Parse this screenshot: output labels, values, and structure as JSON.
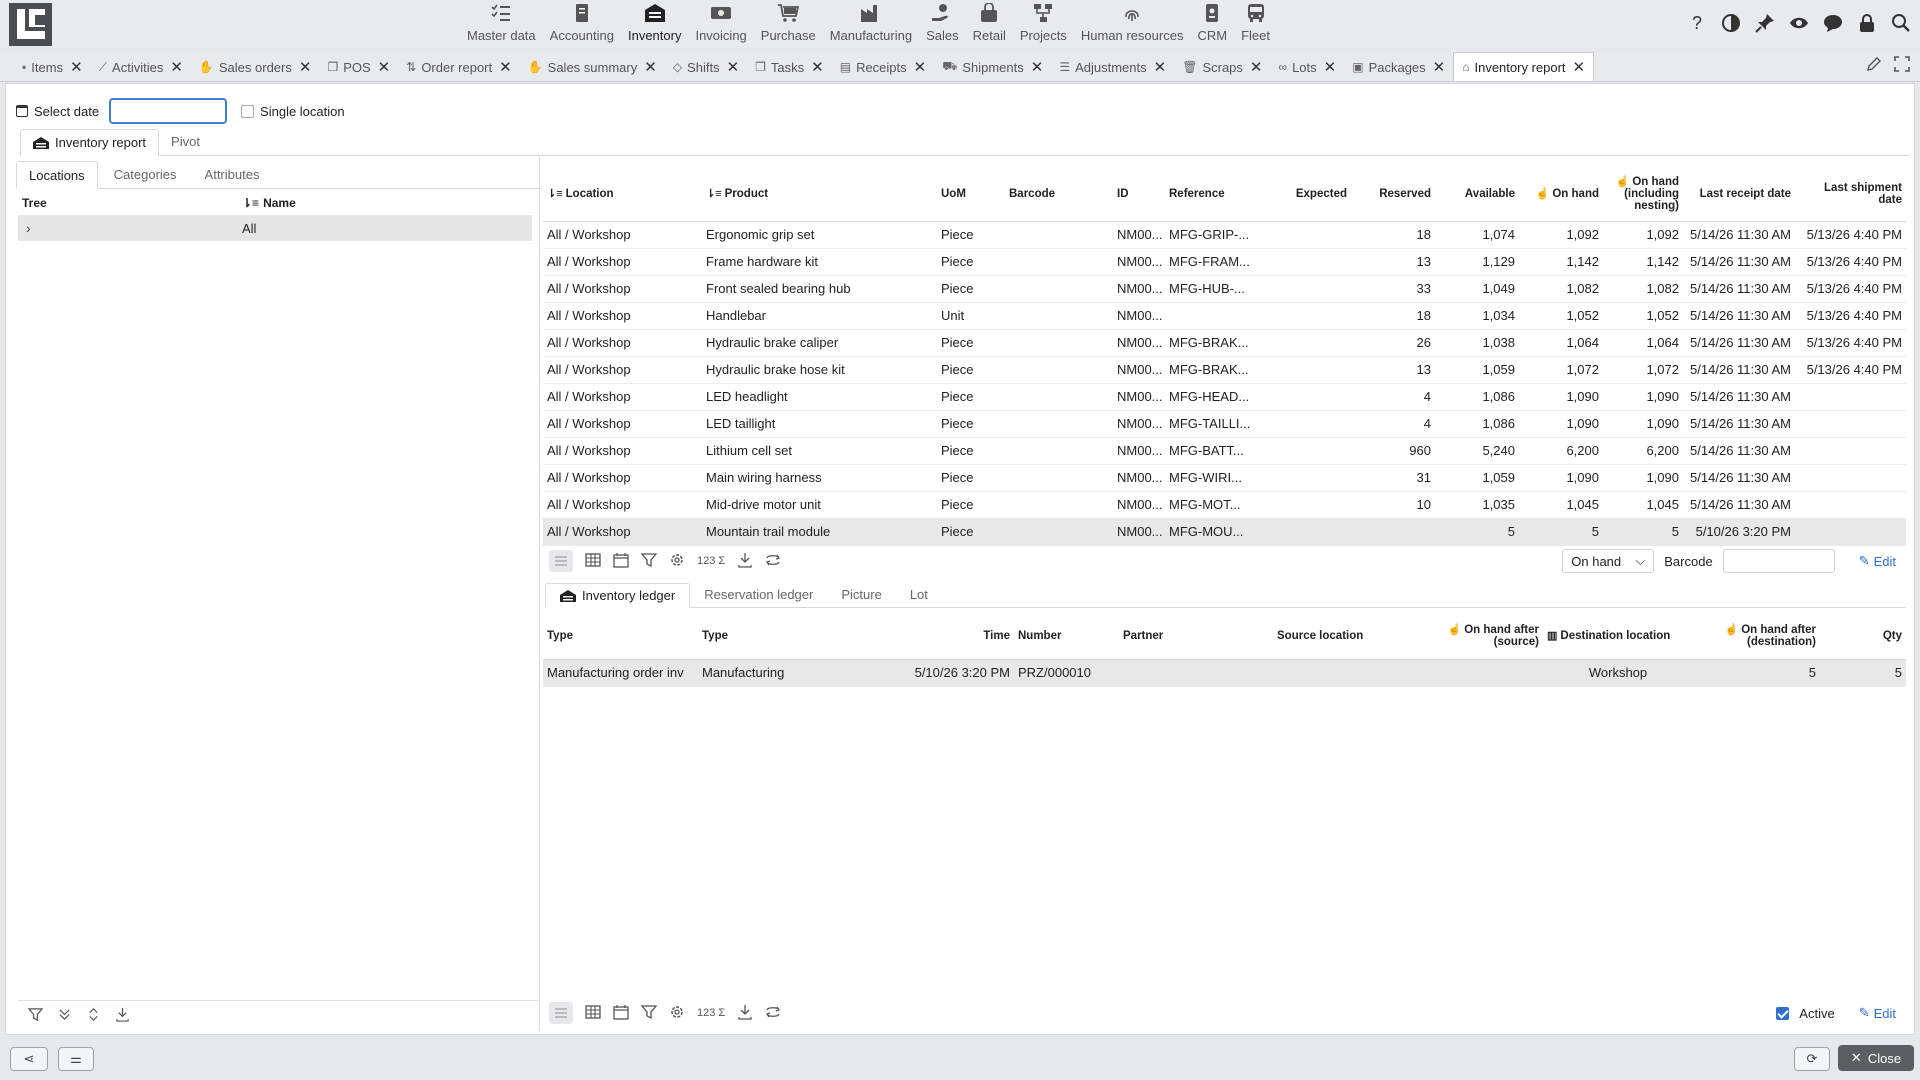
{
  "topmenu": {
    "modules": [
      {
        "label": "Master data",
        "icon": "list-check-icon"
      },
      {
        "label": "Accounting",
        "icon": "ledger-icon"
      },
      {
        "label": "Inventory",
        "icon": "warehouse-icon"
      },
      {
        "label": "Invoicing",
        "icon": "cash-icon"
      },
      {
        "label": "Purchase",
        "icon": "cart-icon"
      },
      {
        "label": "Manufacturing",
        "icon": "factory-icon"
      },
      {
        "label": "Sales",
        "icon": "sales-hand-icon"
      },
      {
        "label": "Retail",
        "icon": "shopping-bag-icon"
      },
      {
        "label": "Projects",
        "icon": "hierarchy-icon"
      },
      {
        "label": "Human resources",
        "icon": "fingerprint-icon"
      },
      {
        "label": "CRM",
        "icon": "id-badge-icon"
      },
      {
        "label": "Fleet",
        "icon": "bus-icon"
      }
    ],
    "active": "Inventory",
    "tools": [
      "help-icon",
      "contrast-icon",
      "pin-icon",
      "eye-icon",
      "chat-icon",
      "lock-icon",
      "search-icon"
    ]
  },
  "doctabs": [
    {
      "label": "Items"
    },
    {
      "label": "Activities"
    },
    {
      "label": "Sales orders"
    },
    {
      "label": "POS"
    },
    {
      "label": "Order report"
    },
    {
      "label": "Sales summary"
    },
    {
      "label": "Shifts"
    },
    {
      "label": "Tasks"
    },
    {
      "label": "Receipts"
    },
    {
      "label": "Shipments"
    },
    {
      "label": "Adjustments"
    },
    {
      "label": "Scraps"
    },
    {
      "label": "Lots"
    },
    {
      "label": "Packages"
    },
    {
      "label": "Inventory report"
    }
  ],
  "filter": {
    "select_date_label": "Select date",
    "date_value": "",
    "single_location_label": "Single location"
  },
  "subtabs": [
    "Inventory report",
    "Pivot"
  ],
  "leftpane": {
    "tabs": [
      "Locations",
      "Categories",
      "Attributes"
    ],
    "col_tree": "Tree",
    "col_name": "Name",
    "rows": [
      {
        "name": "All"
      }
    ]
  },
  "report": {
    "columns": {
      "location": "Location",
      "product": "Product",
      "uom": "UoM",
      "barcode": "Barcode",
      "id": "ID",
      "reference": "Reference",
      "expected": "Expected",
      "reserved": "Reserved",
      "available": "Available",
      "on_hand": "On hand",
      "on_hand_nesting": "On hand (including nesting)",
      "last_receipt": "Last receipt date",
      "last_shipment": "Last shipment date"
    },
    "rows": [
      {
        "location": "All / Workshop",
        "product": "Ergonomic grip set",
        "uom": "Piece",
        "barcode": "",
        "id": "NM00...",
        "reference": "MFG-GRIP-...",
        "expected": "",
        "reserved": "18",
        "available": "1,074",
        "on_hand": "1,092",
        "on_hand_nesting": "1,092",
        "last_receipt": "5/14/26 11:30 AM",
        "last_shipment": "5/13/26 4:40 PM"
      },
      {
        "location": "All / Workshop",
        "product": "Frame hardware kit",
        "uom": "Piece",
        "barcode": "",
        "id": "NM00...",
        "reference": "MFG-FRAM...",
        "expected": "",
        "reserved": "13",
        "available": "1,129",
        "on_hand": "1,142",
        "on_hand_nesting": "1,142",
        "last_receipt": "5/14/26 11:30 AM",
        "last_shipment": "5/13/26 4:40 PM"
      },
      {
        "location": "All / Workshop",
        "product": "Front sealed bearing hub",
        "uom": "Piece",
        "barcode": "",
        "id": "NM00...",
        "reference": "MFG-HUB-...",
        "expected": "",
        "reserved": "33",
        "available": "1,049",
        "on_hand": "1,082",
        "on_hand_nesting": "1,082",
        "last_receipt": "5/14/26 11:30 AM",
        "last_shipment": "5/13/26 4:40 PM"
      },
      {
        "location": "All / Workshop",
        "product": "Handlebar",
        "uom": "Unit",
        "barcode": "",
        "id": "NM00...",
        "reference": "",
        "expected": "",
        "reserved": "18",
        "available": "1,034",
        "on_hand": "1,052",
        "on_hand_nesting": "1,052",
        "last_receipt": "5/14/26 11:30 AM",
        "last_shipment": "5/13/26 4:40 PM"
      },
      {
        "location": "All / Workshop",
        "product": "Hydraulic brake caliper",
        "uom": "Piece",
        "barcode": "",
        "id": "NM00...",
        "reference": "MFG-BRAK...",
        "expected": "",
        "reserved": "26",
        "available": "1,038",
        "on_hand": "1,064",
        "on_hand_nesting": "1,064",
        "last_receipt": "5/14/26 11:30 AM",
        "last_shipment": "5/13/26 4:40 PM"
      },
      {
        "location": "All / Workshop",
        "product": "Hydraulic brake hose kit",
        "uom": "Piece",
        "barcode": "",
        "id": "NM00...",
        "reference": "MFG-BRAK...",
        "expected": "",
        "reserved": "13",
        "available": "1,059",
        "on_hand": "1,072",
        "on_hand_nesting": "1,072",
        "last_receipt": "5/14/26 11:30 AM",
        "last_shipment": "5/13/26 4:40 PM"
      },
      {
        "location": "All / Workshop",
        "product": "LED headlight",
        "uom": "Piece",
        "barcode": "",
        "id": "NM00...",
        "reference": "MFG-HEAD...",
        "expected": "",
        "reserved": "4",
        "available": "1,086",
        "on_hand": "1,090",
        "on_hand_nesting": "1,090",
        "last_receipt": "5/14/26 11:30 AM",
        "last_shipment": ""
      },
      {
        "location": "All / Workshop",
        "product": "LED taillight",
        "uom": "Piece",
        "barcode": "",
        "id": "NM00...",
        "reference": "MFG-TAILLI...",
        "expected": "",
        "reserved": "4",
        "available": "1,086",
        "on_hand": "1,090",
        "on_hand_nesting": "1,090",
        "last_receipt": "5/14/26 11:30 AM",
        "last_shipment": ""
      },
      {
        "location": "All / Workshop",
        "product": "Lithium cell set",
        "uom": "Piece",
        "barcode": "",
        "id": "NM00...",
        "reference": "MFG-BATT...",
        "expected": "",
        "reserved": "960",
        "available": "5,240",
        "on_hand": "6,200",
        "on_hand_nesting": "6,200",
        "last_receipt": "5/14/26 11:30 AM",
        "last_shipment": ""
      },
      {
        "location": "All / Workshop",
        "product": "Main wiring harness",
        "uom": "Piece",
        "barcode": "",
        "id": "NM00...",
        "reference": "MFG-WIRI...",
        "expected": "",
        "reserved": "31",
        "available": "1,059",
        "on_hand": "1,090",
        "on_hand_nesting": "1,090",
        "last_receipt": "5/14/26 11:30 AM",
        "last_shipment": ""
      },
      {
        "location": "All / Workshop",
        "product": "Mid-drive motor unit",
        "uom": "Piece",
        "barcode": "",
        "id": "NM00...",
        "reference": "MFG-MOT...",
        "expected": "",
        "reserved": "10",
        "available": "1,035",
        "on_hand": "1,045",
        "on_hand_nesting": "1,045",
        "last_receipt": "5/14/26 11:30 AM",
        "last_shipment": ""
      },
      {
        "location": "All / Workshop",
        "product": "Mountain trail module",
        "uom": "Piece",
        "barcode": "",
        "id": "NM00...",
        "reference": "MFG-MOU...",
        "expected": "",
        "reserved": "",
        "available": "5",
        "on_hand": "5",
        "on_hand_nesting": "5",
        "last_receipt": "5/10/26 3:20 PM",
        "last_shipment": ""
      }
    ],
    "selected_row": 11
  },
  "toolbar_mid": {
    "count_label": "123",
    "view_select": "On hand",
    "barcode_label": "Barcode",
    "edit_label": "Edit"
  },
  "ledger_tabs": [
    "Inventory ledger",
    "Reservation ledger",
    "Picture",
    "Lot"
  ],
  "ledger": {
    "columns": {
      "type1": "Type",
      "type2": "Type",
      "time": "Time",
      "number": "Number",
      "partner": "Partner",
      "source": "Source location",
      "after_source": "On hand after (source)",
      "destination": "Destination location",
      "after_dest": "On hand after (destination)",
      "qty": "Qty"
    },
    "rows": [
      {
        "type1": "Manufacturing order inv",
        "type2": "Manufacturing",
        "time": "5/10/26 3:20 PM",
        "number": "PRZ/000010",
        "partner": "",
        "source": "",
        "after_source": "",
        "destination": "Workshop",
        "after_dest": "5",
        "qty": "5"
      }
    ]
  },
  "toolbar_bottom": {
    "count_label": "123",
    "active_label": "Active",
    "edit_label": "Edit"
  },
  "bottombar": {
    "close_label": "Close"
  }
}
